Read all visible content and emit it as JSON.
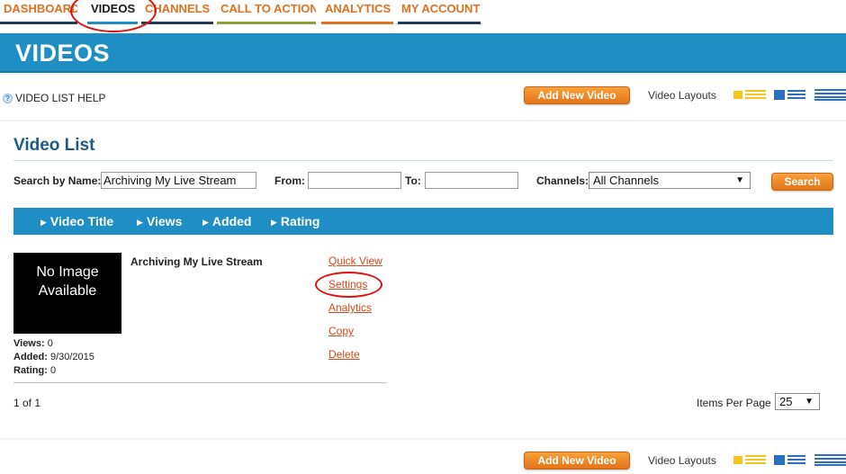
{
  "nav": {
    "tabs": [
      {
        "label": "DASHBOARD"
      },
      {
        "label": "VIDEOS"
      },
      {
        "label": "CHANNELS"
      },
      {
        "label": "CALL TO ACTION"
      },
      {
        "label": "ANALYTICS"
      },
      {
        "label": "MY ACCOUNT"
      }
    ]
  },
  "header": {
    "title": "VIDEOS"
  },
  "toolbar": {
    "help_label": "VIDEO LIST HELP",
    "help_icon": "?",
    "add_button": "Add New Video",
    "layouts_label": "Video Layouts"
  },
  "main": {
    "title": "Video List",
    "search_label": "Search by Name:",
    "search_value": "Archiving My Live Stream",
    "from_label": "From:",
    "from_value": "",
    "to_label": "To:",
    "to_value": "",
    "channels_label": "Channels:",
    "channels_value": "All Channels",
    "search_button": "Search",
    "columns": [
      "Video Title",
      "Views",
      "Added",
      "Rating"
    ],
    "video": {
      "thumb_text": "No Image Available",
      "title": "Archiving My Live Stream",
      "views_label": "Views:",
      "views": "0",
      "added_label": "Added:",
      "added": "9/30/2015",
      "rating_label": "Rating:",
      "rating": "0",
      "actions": [
        "Quick View",
        "Settings",
        "Analytics",
        "Copy",
        "Delete"
      ]
    },
    "pager": "1 of 1",
    "items_per_page_label": "Items Per Page",
    "items_per_page": "25"
  },
  "bottom_toolbar": {
    "add_button": "Add New Video",
    "layouts_label": "Video Layouts"
  },
  "colors": {
    "accent_blue": "#1e8ec4",
    "accent_orange": "#e07020",
    "link_red": "#d24a1e",
    "annotation_red": "#e01010"
  }
}
